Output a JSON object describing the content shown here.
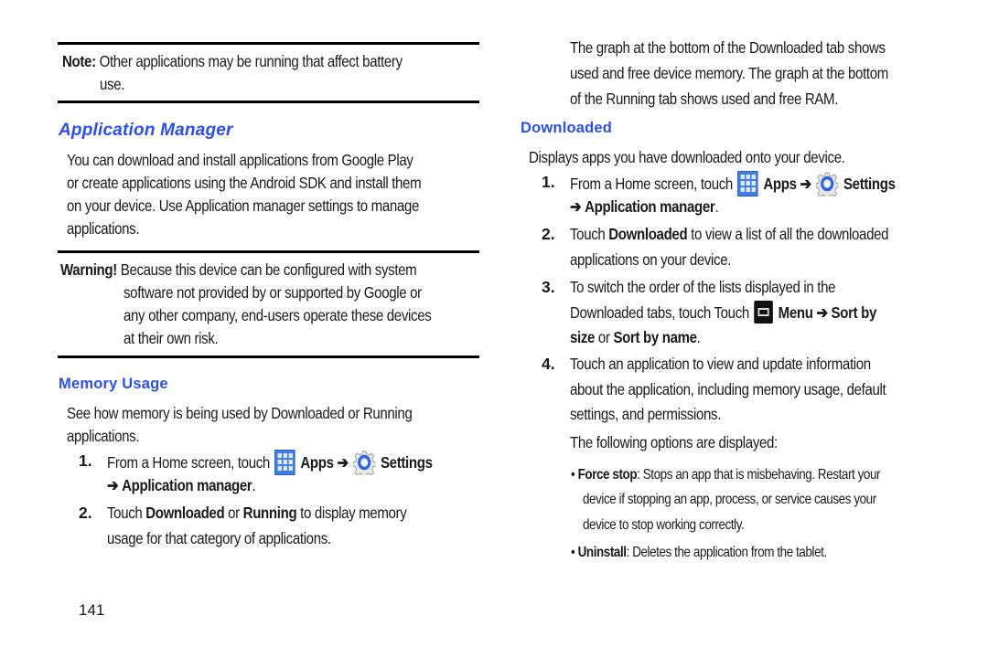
{
  "left": {
    "note": {
      "label": "Note:",
      "line1": "Other applications may be running that affect battery",
      "line2": "use."
    },
    "app_manager": {
      "heading": "Application Manager",
      "lines": [
        "You can download and install applications from Google Play",
        "or create applications using the Android SDK and install them",
        "on your device. Use Application manager settings to manage",
        "applications."
      ]
    },
    "warning": {
      "label": "Warning!",
      "line1": "Because this device can be configured with system",
      "lines": [
        "software not provided by or supported by Google or",
        "any other company, end-users operate these devices",
        "at their own risk."
      ]
    },
    "memory_usage": {
      "heading": "Memory Usage",
      "intro": [
        "See how memory is being used by Downloaded or Running",
        "applications."
      ],
      "step1": {
        "number": "1.",
        "text_pre": "From a Home screen, touch",
        "apps": "Apps",
        "arrow": "➔",
        "settings": "Settings",
        "line2_arrow": "➔",
        "line2_bold": "Application manager",
        "line2_end": "."
      },
      "step2": {
        "number": "2.",
        "pre": "Touch ",
        "b1": "Downloaded",
        "mid": " or ",
        "b2": "Running",
        "post": " to display memory",
        "line2": "usage for that category of applications."
      }
    },
    "page_number": "141"
  },
  "right": {
    "graph_para": [
      "The graph at the bottom of the Downloaded tab shows",
      "used and free device memory. The graph at the bottom",
      "of the Running tab shows used and free RAM."
    ],
    "downloaded": {
      "heading": "Downloaded",
      "intro": "Displays apps you have downloaded onto your device.",
      "step1": {
        "number": "1.",
        "text_pre": "From a Home screen, touch",
        "apps": "Apps",
        "arrow": "➔",
        "settings": "Settings",
        "line2_arrow": "➔",
        "line2_bold": "Application manager",
        "line2_end": "."
      },
      "step2": {
        "number": "2.",
        "pre": "Touch ",
        "b1": "Downloaded",
        "post": " to view a list of all the downloaded",
        "line2": "applications on your device."
      },
      "step3": {
        "number": "3.",
        "line1": "To switch the order of the lists displayed in the",
        "line2_pre": "Downloaded tabs, touch Touch",
        "menu": "Menu",
        "arrow": "➔",
        "sort_by": "Sort by",
        "line3_b1": "size",
        "line3_mid": " or ",
        "line3_b2": "Sort by name",
        "line3_end": "."
      },
      "step4": {
        "number": "4.",
        "lines": [
          "Touch an application to view and update information",
          "about the application, including memory usage, default",
          "settings, and permissions."
        ],
        "following": "The following options are displayed:"
      },
      "options": [
        {
          "bullet": "•",
          "label": "Force stop",
          "text": ": Stops an app that is misbehaving. Restart your",
          "more": [
            "device if stopping an app, process, or service causes your",
            "device to stop working correctly."
          ]
        },
        {
          "bullet": "•",
          "label": "Uninstall",
          "text": ": Deletes the application from the tablet."
        }
      ]
    }
  },
  "colors": {
    "heading_blue": "#2b4ef0",
    "text": "#1a1a1a",
    "rule": "#000000"
  }
}
